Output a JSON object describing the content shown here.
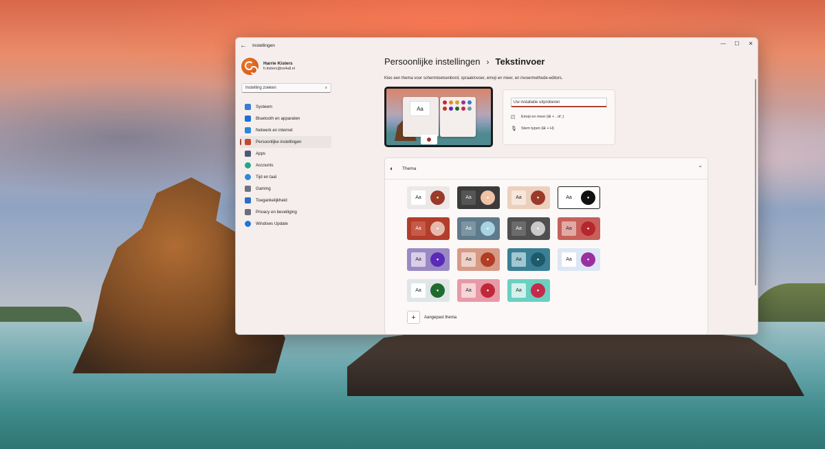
{
  "window": {
    "title": "Instellingen"
  },
  "window_controls": {
    "minimize": "—",
    "maximize": "☐",
    "close": "✕"
  },
  "profile": {
    "name": "Harrie Kisters",
    "email": "h.kisters@xs4all.nl"
  },
  "search": {
    "placeholder": "Instelling zoeken"
  },
  "nav": {
    "items": [
      {
        "label": "Systeem",
        "icon": "monitor-icon",
        "color": "#3a7bd5"
      },
      {
        "label": "Bluetooth en apparaten",
        "icon": "bluetooth-icon",
        "color": "#1f6fd1"
      },
      {
        "label": "Netwerk en internet",
        "icon": "wifi-icon",
        "color": "#2a88d8"
      },
      {
        "label": "Persoonlijke instellingen",
        "icon": "brush-icon",
        "color": "#c24b2e",
        "active": true
      },
      {
        "label": "Apps",
        "icon": "apps-icon",
        "color": "#4a5a7a"
      },
      {
        "label": "Accounts",
        "icon": "person-icon",
        "color": "#1fa88a"
      },
      {
        "label": "Tijd en taal",
        "icon": "globe-clock-icon",
        "color": "#2f8ad6"
      },
      {
        "label": "Gaming",
        "icon": "gamepad-icon",
        "color": "#6c7280"
      },
      {
        "label": "Toegankelijkheid",
        "icon": "accessibility-icon",
        "color": "#2c6fc4"
      },
      {
        "label": "Privacy en beveiliging",
        "icon": "shield-icon",
        "color": "#6b6f78"
      },
      {
        "label": "Windows Update",
        "icon": "update-icon",
        "color": "#1c79d6"
      }
    ]
  },
  "breadcrumb": {
    "parent": "Persoonlijke instellingen",
    "separator": "›",
    "current": "Tekstinvoer"
  },
  "description": "Kies een thema voor schermtoetsenbord, spraakinvoer, emoji en meer, en invoermethode-editors.",
  "preview": {
    "aa_label": "Aa"
  },
  "tryout": {
    "input_placeholder": "Uw installatie uitproberen",
    "emoji_label": "Emoji en meer (⊞ + . of ;)",
    "voice_label": "Stem typen (⊞ + H)"
  },
  "thema": {
    "title": "Thema",
    "aa_label": "Aa",
    "mic_glyph": "🎤",
    "tiles": [
      {
        "bg": "#ece8e8",
        "aa_bg": "#ffffff",
        "aa_fg": "#222222",
        "mic": "#9b3a2a"
      },
      {
        "bg": "#3b3b3b",
        "aa_bg": "#555555",
        "aa_fg": "#f2f2f2",
        "mic": "#f0c2a6"
      },
      {
        "bg": "#ecd0bd",
        "aa_bg": "#f7e6da",
        "aa_fg": "#222222",
        "mic": "#9b3a2a"
      },
      {
        "bg": "#ffffff",
        "aa_bg": "#ffffff",
        "aa_fg": "#111111",
        "mic": "#111111",
        "selected": true
      },
      {
        "bg": "#b23d2a",
        "aa_bg": "#c65a46",
        "aa_fg": "#ffffff",
        "mic": "#e6b9ad"
      },
      {
        "bg": "#5f7a8a",
        "aa_bg": "#7b95a3",
        "aa_fg": "#ffffff",
        "mic": "#a8d3e2"
      },
      {
        "bg": "#4f4f4f",
        "aa_bg": "#6b6b6b",
        "aa_fg": "#ffffff",
        "mic": "#c9c9c9"
      },
      {
        "bg": "#c7605a",
        "aa_bg": "#e2a9a4",
        "aa_fg": "#222222",
        "mic": "#b5272c"
      },
      {
        "bg": "#9a8ac4",
        "aa_bg": "#d9cfe8",
        "aa_fg": "#222222",
        "mic": "#5b2ab8"
      },
      {
        "bg": "#d69a86",
        "aa_bg": "#ecd1c6",
        "aa_fg": "#222222",
        "mic": "#b23c24"
      },
      {
        "bg": "#3b7f95",
        "aa_bg": "#9fc8d3",
        "aa_fg": "#222222",
        "mic": "#1d5a6a"
      },
      {
        "bg": "#dde6f4",
        "aa_bg": "#ffffff",
        "aa_fg": "#222222",
        "mic": "#9a2fa0"
      },
      {
        "bg": "#dfe6e8",
        "aa_bg": "#ffffff",
        "aa_fg": "#222222",
        "mic": "#1f6b2e"
      },
      {
        "bg": "#e79aa6",
        "aa_bg": "#f6d4d8",
        "aa_fg": "#222222",
        "mic": "#c0283a"
      },
      {
        "bg": "#6bcfc1",
        "aa_bg": "#d3f1ec",
        "aa_fg": "#222222",
        "mic": "#c42a4a"
      }
    ],
    "custom_label": "Aangepast thema",
    "custom_button": "+"
  },
  "colors": {
    "accent": "#b5402d",
    "window_bg": "#f5eeec"
  }
}
